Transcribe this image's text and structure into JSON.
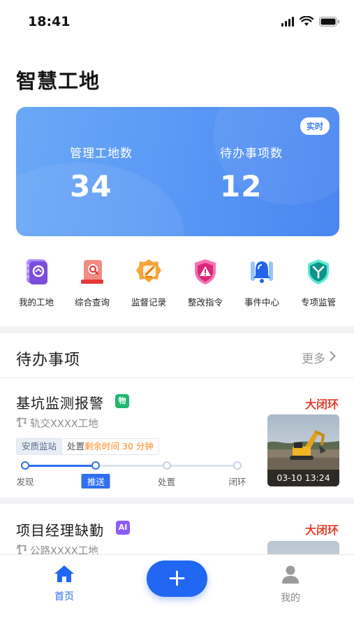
{
  "status": {
    "time": "18:41"
  },
  "page": {
    "title": "智慧工地"
  },
  "hero": {
    "badge": "实时",
    "stats": [
      {
        "label": "管理工地数",
        "value": "34"
      },
      {
        "label": "待办事项数",
        "value": "12"
      }
    ]
  },
  "quick_menu": [
    {
      "label": "我的工地",
      "icon": "site-book-icon",
      "color": "#8b5cf6"
    },
    {
      "label": "综合查询",
      "icon": "search-query-icon",
      "color": "#ef5350"
    },
    {
      "label": "监督记录",
      "icon": "record-edit-icon",
      "color": "#f59e0b"
    },
    {
      "label": "整改指令",
      "icon": "warning-shield-icon",
      "color": "#ec4899"
    },
    {
      "label": "事件中心",
      "icon": "bell-icon",
      "color": "#2f6ff0"
    },
    {
      "label": "专项监管",
      "icon": "special-shield-icon",
      "color": "#14b8a6"
    }
  ],
  "todo": {
    "title": "待办事项",
    "more": "更多",
    "items": [
      {
        "title": "基坑监测报警",
        "tag": "物",
        "tag_color": "#1fb86d",
        "loop": "大闭环",
        "site": "轨交XXXX工地",
        "chip_dept": "安质监站",
        "chip_prefix": "处置",
        "chip_remaining": "剩余时间 30 分钟",
        "photo_time": "03-10 13:24",
        "steps": [
          "发现",
          "推送",
          "处置",
          "闭环"
        ],
        "active_step": 1,
        "progress": 0.333
      },
      {
        "title": "项目经理缺勤",
        "tag": "AI",
        "tag_color": "#8b5cf6",
        "loop": "大闭环",
        "site": "公路XXXX工地"
      }
    ]
  },
  "bottom_nav": {
    "home": "首页",
    "add": "+",
    "me": "我的"
  },
  "colors": {
    "primary": "#2f6ff0",
    "alert": "#e53d2c",
    "orange": "#ff8a1f"
  }
}
